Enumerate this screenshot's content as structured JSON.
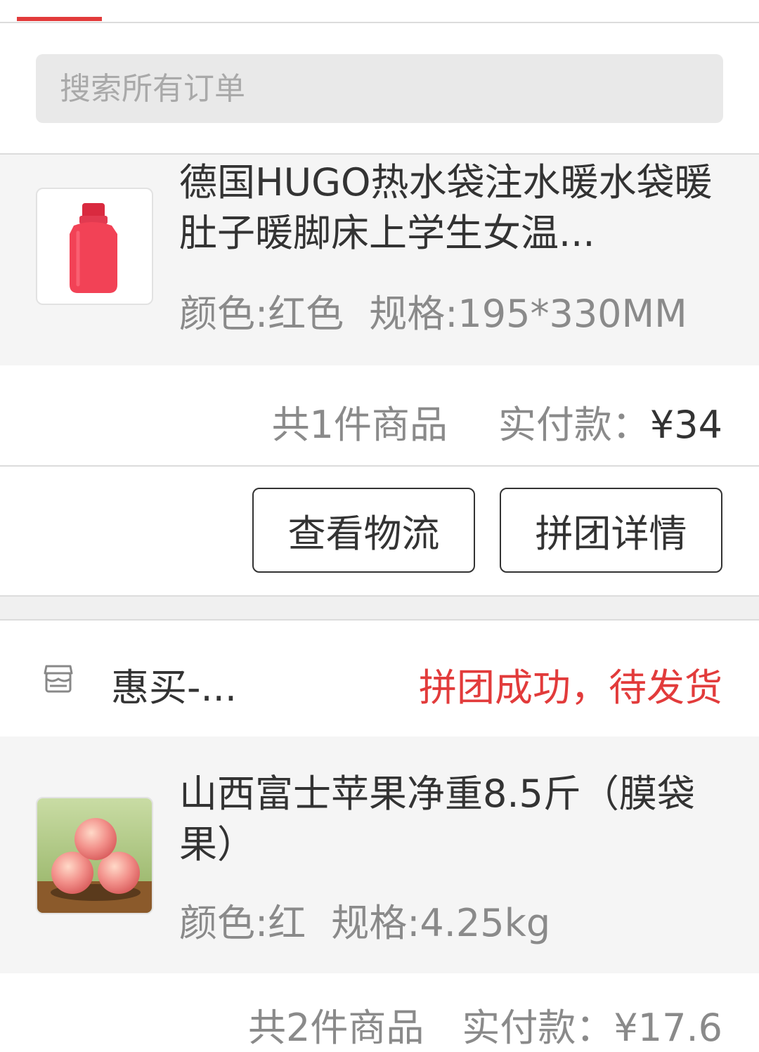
{
  "search": {
    "placeholder": "搜索所有订单"
  },
  "orders": [
    {
      "product": {
        "title": "德国HUGO热水袋注水暖水袋暖肚子暖脚床上学生女温...",
        "color": "颜色:红色",
        "spec": "规格:195*330MM",
        "image_icon": "hot-water-bottle"
      },
      "summary": {
        "count": "共1件商品",
        "paid_label": "实付款：",
        "paid_amount": "¥34"
      },
      "actions": {
        "logistics": "查看物流",
        "group_details": "拼团详情"
      }
    },
    {
      "shop": {
        "icon": "store-icon",
        "name": "惠买-..."
      },
      "status": "拼团成功，待发货",
      "product": {
        "title": "山西富士苹果净重8.5斤（膜袋果）",
        "color": "颜色:红",
        "spec": "规格:4.25kg",
        "image_icon": "apples"
      },
      "summary_partial": "共2件商品　实付款：¥17.6"
    }
  ],
  "colors": {
    "accent": "#e23b3b",
    "text_primary": "#333333",
    "text_secondary": "#8a8a8a",
    "block_bg": "#f5f5f5"
  }
}
